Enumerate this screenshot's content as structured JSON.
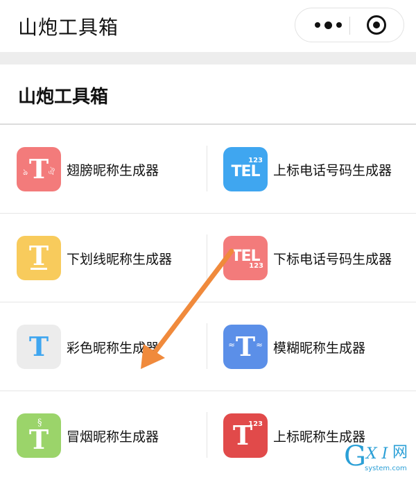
{
  "nav": {
    "title": "山炮工具箱",
    "menu_icon": "more-dots-icon",
    "close_icon": "target-circle-icon"
  },
  "section": {
    "title": "山炮工具箱"
  },
  "tools": [
    {
      "label": "翅膀昵称生成器",
      "icon": "wing-t-icon",
      "icon_text": "T",
      "color": "#f37b7b"
    },
    {
      "label": "上标电话号码生成器",
      "icon": "tel-superscript-icon",
      "icon_text": "TEL",
      "icon_sup": "123",
      "color": "#3fa6f0"
    },
    {
      "label": "下划线昵称生成器",
      "icon": "underline-t-icon",
      "icon_text": "T",
      "color": "#f8cb5c"
    },
    {
      "label": "下标电话号码生成器",
      "icon": "tel-subscript-icon",
      "icon_text": "TEL",
      "icon_sup": "123",
      "color": "#f37b7b"
    },
    {
      "label": "彩色昵称生成器",
      "icon": "color-t-icon",
      "icon_text": "T",
      "color": "#ececec",
      "text_color": "#3fa6f0"
    },
    {
      "label": "模糊昵称生成器",
      "icon": "blur-t-icon",
      "icon_text": "T",
      "color": "#5b8fe8"
    },
    {
      "label": "冒烟昵称生成器",
      "icon": "smoke-t-icon",
      "icon_text": "T",
      "color": "#9bd46a"
    },
    {
      "label": "上标昵称生成器",
      "icon": "superscript-t-icon",
      "icon_text": "T",
      "icon_sup": "123",
      "color": "#e14a4a"
    }
  ],
  "annotation": {
    "color": "#f08a3c"
  },
  "watermark": {
    "logo": "G",
    "xi": "X I",
    "wang": "网",
    "domain": "system.com"
  }
}
